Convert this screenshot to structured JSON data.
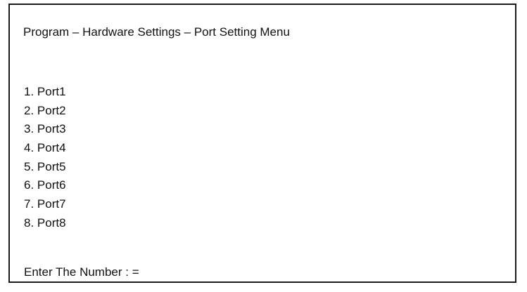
{
  "menu": {
    "title": "Program – Hardware Settings – Port Setting Menu",
    "items": [
      {
        "label": "1. Port1"
      },
      {
        "label": "2. Port2"
      },
      {
        "label": "3. Port3"
      },
      {
        "label": "4. Port4"
      },
      {
        "label": "5. Port5"
      },
      {
        "label": "6. Port6"
      },
      {
        "label": "7. Port7"
      },
      {
        "label": "8. Port8"
      }
    ],
    "prompt": "Enter The Number : =",
    "input_value": ""
  }
}
